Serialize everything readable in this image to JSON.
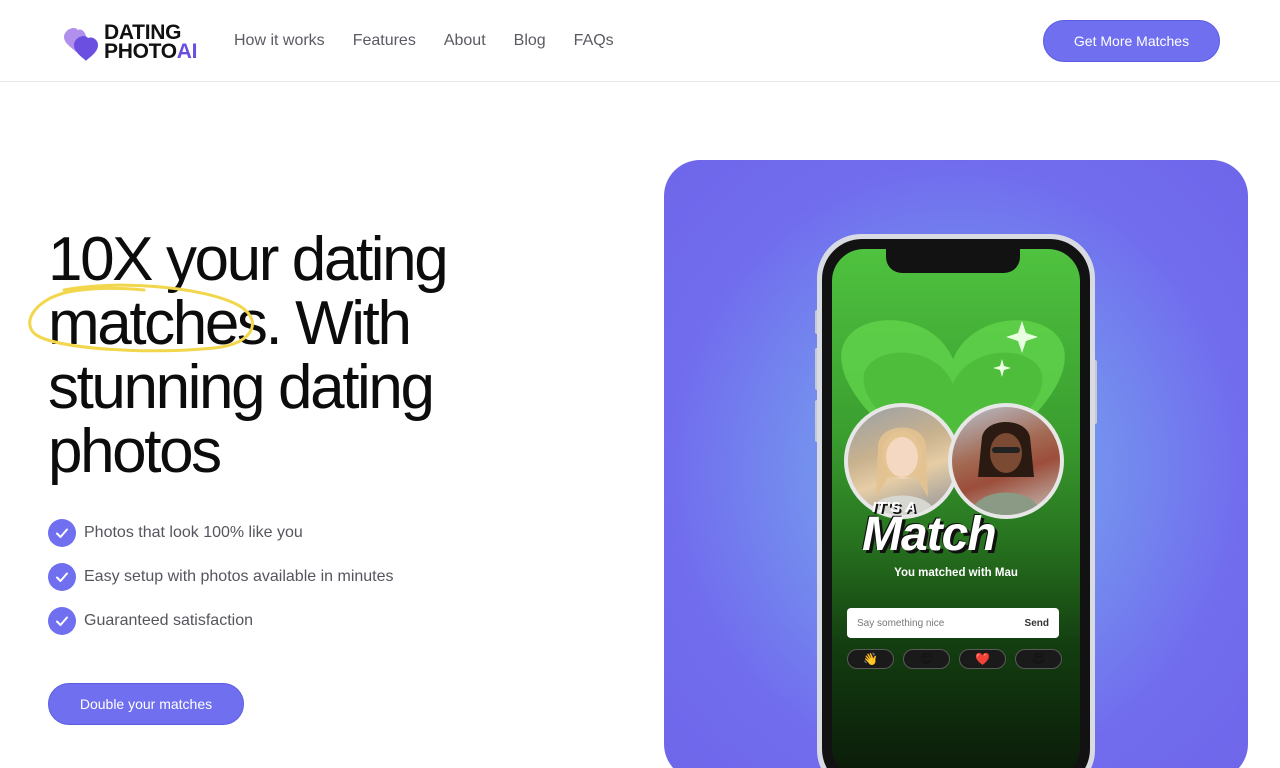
{
  "brand": {
    "line1": "DATING",
    "line2": "PHOTO",
    "line2_accent": "AI"
  },
  "nav": {
    "items": [
      "How it works",
      "Features",
      "About",
      "Blog",
      "FAQs"
    ]
  },
  "header": {
    "cta_label": "Get More Matches"
  },
  "hero": {
    "headline": [
      "10X your dating",
      "matches. With",
      "stunning dating",
      "photos"
    ],
    "features": [
      "Photos that look 100% like you",
      "Easy setup with photos available in minutes",
      "Guaranteed satisfaction"
    ],
    "cta_label": "Double your matches"
  },
  "phone": {
    "its_a": "IT'S A",
    "match": "Match",
    "caption": "You matched with Mau",
    "message_placeholder": "Say something nice",
    "send_label": "Send",
    "emojis": [
      "👋",
      "😉",
      "❤️",
      "😍"
    ]
  },
  "colors": {
    "accent": "#6f6ff0",
    "logo_purple": "#6b4fe0",
    "highlight": "#f2d64b"
  }
}
